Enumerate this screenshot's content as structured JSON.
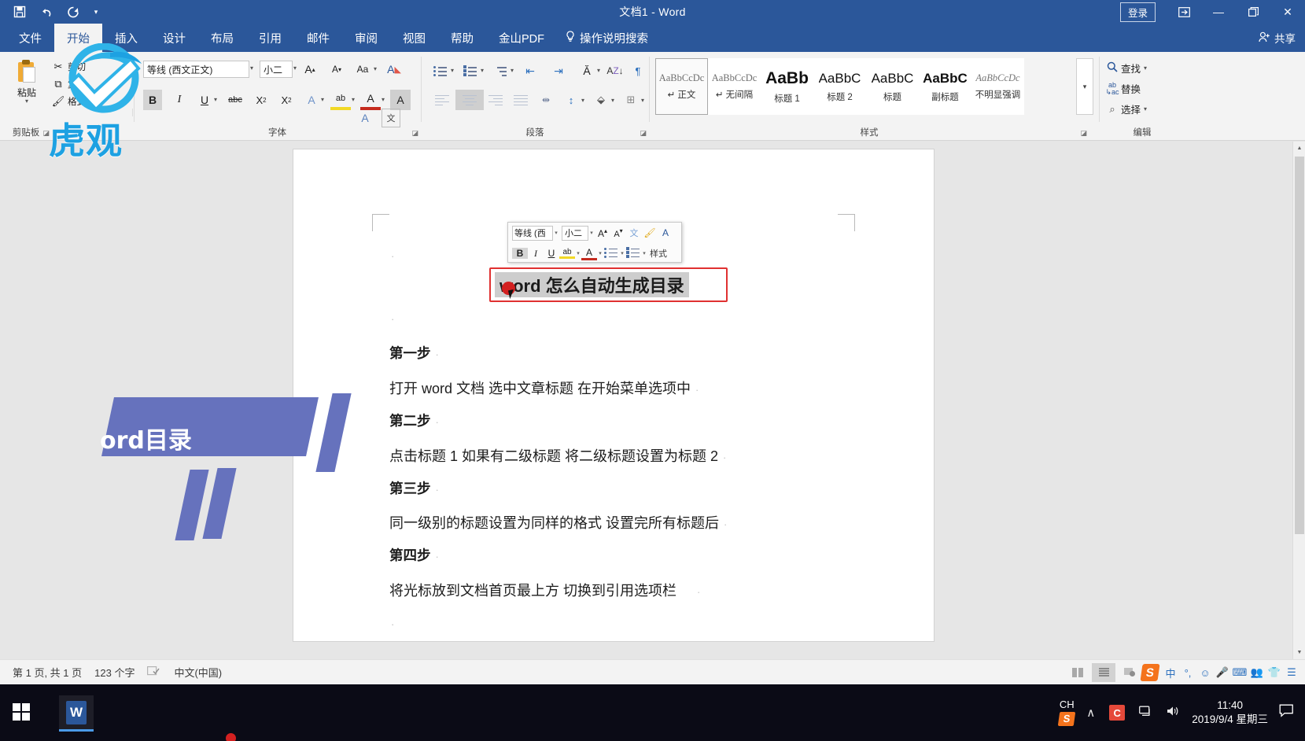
{
  "titlebar": {
    "document_title": "文档1  -  Word",
    "quick_access": [
      {
        "name": "save",
        "glyph": "ὋE"
      },
      {
        "name": "undo",
        "glyph": "↶"
      },
      {
        "name": "redo",
        "glyph": "↻"
      },
      {
        "name": "customize",
        "glyph": "▾"
      }
    ],
    "signin_label": "登录",
    "ribbon_display_glyph": "⬚",
    "minimize_glyph": "—",
    "restore_glyph": "❐",
    "close_glyph": "✕",
    "accent_color": "#2b579a"
  },
  "tabs": {
    "items": [
      {
        "label": "文件",
        "active": false
      },
      {
        "label": "开始",
        "active": true
      },
      {
        "label": "插入",
        "active": false
      },
      {
        "label": "设计",
        "active": false
      },
      {
        "label": "布局",
        "active": false
      },
      {
        "label": "引用",
        "active": false
      },
      {
        "label": "邮件",
        "active": false
      },
      {
        "label": "审阅",
        "active": false
      },
      {
        "label": "视图",
        "active": false
      },
      {
        "label": "帮助",
        "active": false
      },
      {
        "label": "金山PDF",
        "active": false
      }
    ],
    "tell_me": "操作说明搜索",
    "tell_me_icon": "bulb-icon",
    "share_label": "共享",
    "share_icon": "person-add-icon"
  },
  "ribbon": {
    "groups": [
      {
        "name": "clipboard",
        "label": "剪贴板"
      },
      {
        "name": "font",
        "label": "字体"
      },
      {
        "name": "paragraph",
        "label": "段落"
      },
      {
        "name": "styles",
        "label": "样式"
      },
      {
        "name": "editing",
        "label": "编辑"
      }
    ],
    "clipboard": {
      "paste_label": "粘贴",
      "commands": [
        {
          "label": "剪切",
          "icon": "scissors-icon"
        },
        {
          "label": "复制",
          "icon": "copy-icon"
        },
        {
          "label": "格式刷",
          "icon": "format-painter-icon"
        }
      ]
    },
    "font": {
      "font_name_value": "等线 (西文正文)",
      "font_size_value": "小二",
      "grow_font": "A",
      "shrink_font": "A",
      "change_case": "Aa",
      "clear_formatting": "A",
      "phonetic_guide": "文",
      "char_border": "A",
      "bold": "B",
      "italic": "I",
      "underline": "U",
      "strikethrough": "abc",
      "subscript": "X",
      "superscript": "X",
      "text_effects": "A",
      "highlight": "ab",
      "font_color": "A",
      "shading": "A",
      "enclose_char": "字"
    },
    "paragraph": {
      "bullets": "bullet-list-icon",
      "numbering": "numbered-list-icon",
      "multilevel": "multilevel-list-icon",
      "decrease_indent": "decrease-indent-icon",
      "increase_indent": "increase-indent-icon",
      "cjk_layout": "cjk-layout-icon",
      "sort": "sort-az-icon",
      "show_marks": "show-paragraph-marks-icon",
      "align_left": "align-left-icon",
      "align_center": "align-center-icon",
      "align_right": "align-right-icon",
      "justify": "justify-icon",
      "distribute": "distribute-icon",
      "line_spacing": "line-spacing-icon",
      "shading": "paragraph-shading-icon",
      "borders": "borders-icon"
    },
    "styles": {
      "gallery": [
        {
          "preview": "AaBbCcDc",
          "name": "正文",
          "selected": true,
          "pilcrow": true,
          "kind": "small"
        },
        {
          "preview": "AaBbCcDc",
          "name": "无间隔",
          "selected": false,
          "pilcrow": true,
          "kind": "small"
        },
        {
          "preview": "AaBb",
          "name": "标题 1",
          "selected": false,
          "pilcrow": false,
          "kind": "big"
        },
        {
          "preview": "AaBbC",
          "name": "标题 2",
          "selected": false,
          "pilcrow": false,
          "kind": "h2"
        },
        {
          "preview": "AaBbC",
          "name": "标题",
          "selected": false,
          "pilcrow": false,
          "kind": "h"
        },
        {
          "preview": "AaBbC",
          "name": "副标题",
          "selected": false,
          "pilcrow": false,
          "kind": "sub"
        },
        {
          "preview": "AaBbCcDc",
          "name": "不明显强调",
          "selected": false,
          "pilcrow": false,
          "kind": "em"
        }
      ],
      "more_glyph": "▾"
    },
    "editing": {
      "find_label": "查找",
      "find_icon": "search-icon",
      "replace_label": "替换",
      "replace_icon": "replace-icon",
      "select_label": "选择",
      "select_icon": "pointer-icon"
    }
  },
  "mini_toolbar": {
    "font_name": "等线 (西",
    "font_size": "小二",
    "grow": "A",
    "shrink": "A",
    "phonetic": "文",
    "painter": "format-painter-icon",
    "text_effect": "A",
    "bold": "B",
    "italic": "I",
    "underline": "U",
    "highlight": "ab",
    "font_color": "A",
    "bullets": "bullet-list-icon",
    "numbering": "numbered-list-icon",
    "styles_label": "样式"
  },
  "document": {
    "heading": "word 怎么自动生成目录",
    "heading_selection_color": "#e03131",
    "paragraph_mark": "·",
    "paragraphs": [
      {
        "type": "step",
        "text": "第一步"
      },
      {
        "type": "text",
        "text": "打开 word 文档   选中文章标题  在开始菜单选项中"
      },
      {
        "type": "step",
        "text": "第二步"
      },
      {
        "type": "text",
        "text": "点击标题 1   如果有二级标题  将二级标题设置为标题 2"
      },
      {
        "type": "step",
        "text": "第三步"
      },
      {
        "type": "text",
        "text": "同一级别的标题设置为同样的格式   设置完所有标题后"
      },
      {
        "type": "step",
        "text": "第四步"
      },
      {
        "type": "text",
        "text": "将光标放到文档首页最上方   切换到引用选项栏"
      }
    ]
  },
  "overlay": {
    "logo_text": "虎观",
    "logo_icon": "tiger-G-logo",
    "deco_text": "ord目录",
    "deco_color": "#6672bd"
  },
  "statusbar": {
    "page_info": "第 1 页, 共 1 页",
    "word_count": "123 个字",
    "proofing_icon": "proofing-icon",
    "language": "中文(中国)",
    "views": [
      {
        "name": "read-mode",
        "active": false
      },
      {
        "name": "print-layout",
        "active": true
      },
      {
        "name": "web-layout",
        "active": false
      }
    ],
    "tray": {
      "ime_logo": "sogou-icon",
      "ime_mode": "中",
      "items": [
        "°,",
        "☺",
        "Ἲ4",
        "⌨",
        "὆5",
        "ὅ5",
        "☰"
      ]
    }
  },
  "taskbar": {
    "start_icon": "windows-start-icon",
    "apps": [
      {
        "name": "word-taskbar-item",
        "glyph": "W"
      }
    ],
    "ime_label": "CH",
    "ime_icon": "sogou-icon",
    "tray_icons": [
      {
        "name": "show-hidden-icons",
        "glyph": "∧"
      },
      {
        "name": "camtasia-icon",
        "glyph": "C"
      },
      {
        "name": "network-icon",
        "glyph": "὚5"
      },
      {
        "name": "volume-icon",
        "glyph": "ὐA"
      }
    ],
    "clock_time": "11:40",
    "clock_date": "2019/9/4 星期三",
    "notification_icon": "notification-icon"
  }
}
